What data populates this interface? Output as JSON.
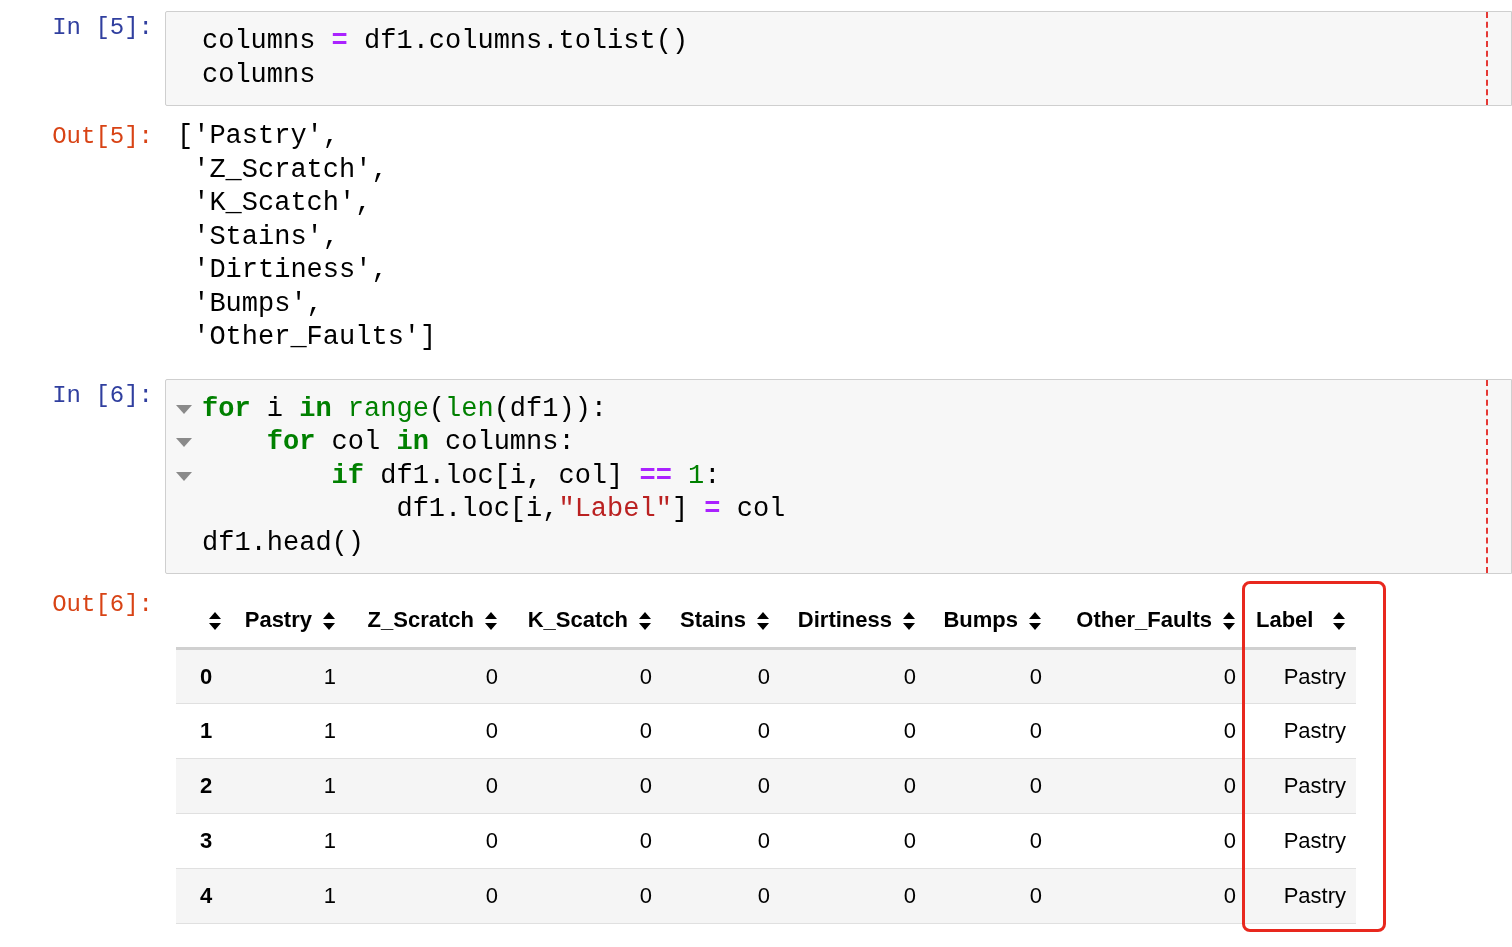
{
  "cells": [
    {
      "kind": "code",
      "prompt": "In [5]:",
      "lines": [
        {
          "fold": false,
          "tokens": [
            {
              "kind": "plain",
              "t": "columns"
            },
            {
              "kind": "operator",
              "t": " ="
            },
            {
              "kind": "plain",
              "t": " df1.columns.tolist()"
            }
          ]
        },
        {
          "fold": false,
          "tokens": [
            {
              "kind": "plain",
              "t": "columns"
            }
          ]
        }
      ]
    },
    {
      "kind": "text",
      "prompt": "Out[5]:",
      "lines": [
        "['Pastry',",
        " 'Z_Scratch',",
        " 'K_Scatch',",
        " 'Stains',",
        " 'Dirtiness',",
        " 'Bumps',",
        " 'Other_Faults']"
      ]
    },
    {
      "kind": "code",
      "prompt": "In [6]:",
      "lines": [
        {
          "fold": true,
          "tokens": [
            {
              "kind": "keyword",
              "t": "for"
            },
            {
              "kind": "plain",
              "t": " i"
            },
            {
              "kind": "keyword",
              "t": " in"
            },
            {
              "kind": "builtin",
              "t": " range"
            },
            {
              "kind": "plain",
              "t": "("
            },
            {
              "kind": "builtin",
              "t": "len"
            },
            {
              "kind": "plain",
              "t": "(df1)):"
            }
          ]
        },
        {
          "fold": true,
          "tokens": [
            {
              "kind": "keyword",
              "t": "    for"
            },
            {
              "kind": "plain",
              "t": " col"
            },
            {
              "kind": "keyword",
              "t": " in"
            },
            {
              "kind": "plain",
              "t": " columns:"
            }
          ]
        },
        {
          "fold": true,
          "tokens": [
            {
              "kind": "keyword",
              "t": "        if"
            },
            {
              "kind": "plain",
              "t": " df1.loc[i, col]"
            },
            {
              "kind": "operator",
              "t": " =="
            },
            {
              "kind": "number",
              "t": " 1"
            },
            {
              "kind": "plain",
              "t": ":"
            }
          ]
        },
        {
          "fold": false,
          "tokens": [
            {
              "kind": "plain",
              "t": "            df1.loc[i,"
            },
            {
              "kind": "string",
              "t": "\"Label\""
            },
            {
              "kind": "plain",
              "t": "]"
            },
            {
              "kind": "operator",
              "t": " ="
            },
            {
              "kind": "plain",
              "t": " col"
            }
          ]
        },
        {
          "fold": false,
          "tokens": [
            {
              "kind": "plain",
              "t": "df1.head()"
            }
          ]
        }
      ]
    },
    {
      "kind": "table",
      "prompt": "Out[6]:",
      "table": {
        "columns": [
          {
            "highlighted": false
          },
          {
            "label": "Pastry",
            "highlighted": false
          },
          {
            "label": "Z_Scratch",
            "highlighted": false
          },
          {
            "label": "K_Scatch",
            "highlighted": false
          },
          {
            "label": "Stains",
            "highlighted": false
          },
          {
            "label": "Dirtiness",
            "highlighted": false
          },
          {
            "label": "Bumps",
            "highlighted": false
          },
          {
            "label": "Other_Faults",
            "highlighted": false
          },
          {
            "label": "Label",
            "highlighted": true
          }
        ],
        "rows": [
          [
            "0",
            "1",
            "0",
            "0",
            "0",
            "0",
            "0",
            "0",
            "Pastry"
          ],
          [
            "1",
            "1",
            "0",
            "0",
            "0",
            "0",
            "0",
            "0",
            "Pastry"
          ],
          [
            "2",
            "1",
            "0",
            "0",
            "0",
            "0",
            "0",
            "0",
            "Pastry"
          ],
          [
            "3",
            "1",
            "0",
            "0",
            "0",
            "0",
            "0",
            "0",
            "Pastry"
          ],
          [
            "4",
            "1",
            "0",
            "0",
            "0",
            "0",
            "0",
            "0",
            "Pastry"
          ]
        ]
      }
    }
  ]
}
